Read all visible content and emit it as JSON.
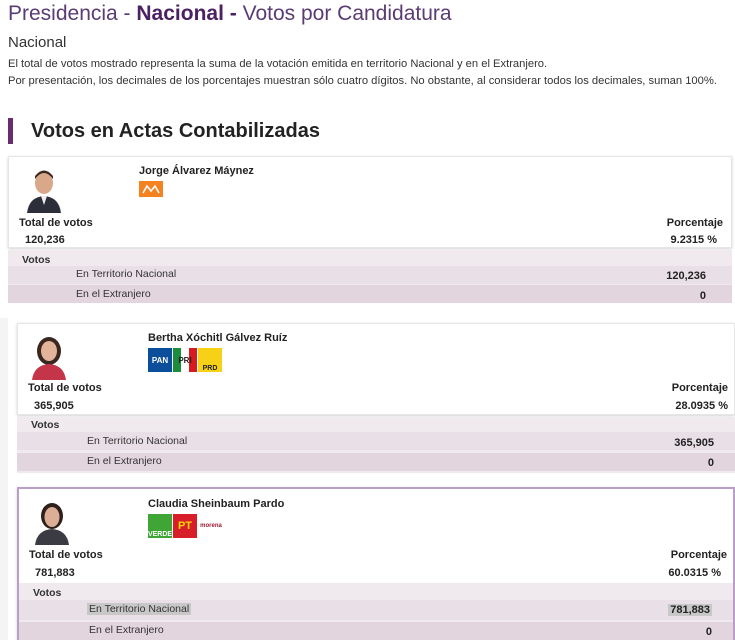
{
  "header": {
    "title_prefix": "Presidencia - ",
    "title_bold": "Nacional",
    "title_sep": " - ",
    "title_suffix": "Votos por Candidatura",
    "subtitle": "Nacional",
    "desc1": "El total de votos mostrado representa la suma de la votación emitida en territorio Nacional y en el Extranjero.",
    "desc2": "Por presentación, los decimales de los porcentajes muestran sólo cuatro dígitos. No obstante, al considerar todos los decimales, suman 100%."
  },
  "section_title": "Votos en Actas Contabilizadas",
  "labels": {
    "total": "Total de votos",
    "percent": "Porcentaje",
    "votos": "Votos",
    "territorio": "En Territorio Nacional",
    "extranjero": "En el Extranjero"
  },
  "candidates": [
    {
      "name": "Jorge Álvarez Máynez",
      "total": "120,236",
      "percent": "9.2315 %",
      "territorio": "120,236",
      "extranjero": "0",
      "parties": [
        {
          "icon": "movimiento-ciudadano-logo",
          "color": "#f58220",
          "text": ""
        }
      ]
    },
    {
      "name": "Bertha Xóchitl Gálvez Ruíz",
      "total": "365,905",
      "percent": "28.0935 %",
      "territorio": "365,905",
      "extranjero": "0",
      "parties": [
        {
          "icon": "pan-logo",
          "color": "#0b4f9c",
          "text": "PAN"
        },
        {
          "icon": "pri-logo",
          "color": "#d71920",
          "text": "PRI"
        },
        {
          "icon": "prd-logo",
          "color": "#f7d117",
          "text": "PRD"
        }
      ]
    },
    {
      "name": "Claudia Sheinbaum Pardo",
      "total": "781,883",
      "percent": "60.0315 %",
      "territorio": "781,883",
      "extranjero": "0",
      "parties": [
        {
          "icon": "verde-logo",
          "color": "#3fa535",
          "text": "VERDE"
        },
        {
          "icon": "pt-logo",
          "color": "#d81e28",
          "text": "PT"
        },
        {
          "icon": "morena-logo",
          "color": "#ffffff",
          "text": "morena"
        }
      ]
    }
  ]
}
